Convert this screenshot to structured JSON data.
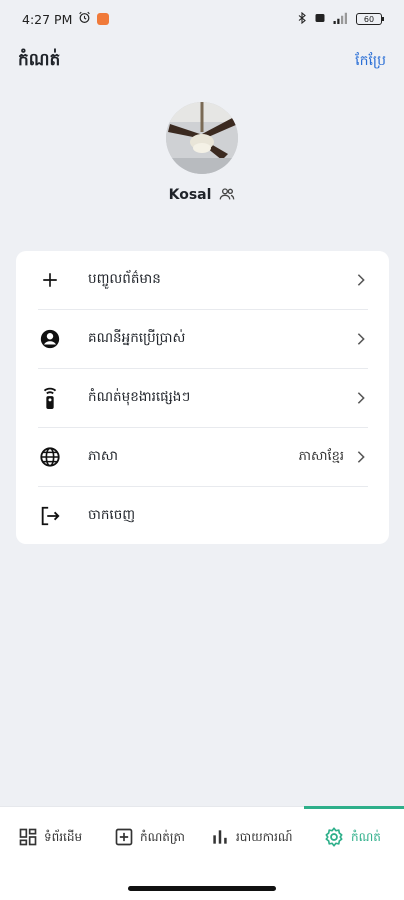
{
  "status_bar": {
    "time": "4:27 PM",
    "alarm_icon": "alarm-icon",
    "battery": "60"
  },
  "header": {
    "title": "កំណត់",
    "edit_label": "កែប្រែ"
  },
  "profile": {
    "username": "Kosal",
    "avatar": "ceiling-fan-photo"
  },
  "menu": {
    "items": [
      {
        "label": "បញ្ចូលព័ត៌មាន",
        "icon": "plus-icon"
      },
      {
        "label": "គណនីអ្នកប្រើប្រាស់",
        "icon": "account-circle-icon"
      },
      {
        "label": "កំណត់មុខងារផ្សេងៗ",
        "icon": "remote-icon"
      },
      {
        "label": "ភាសា",
        "value": "ភាសាខ្មែរ",
        "icon": "globe-icon"
      },
      {
        "label": "ចាកចេញ",
        "icon": "logout-icon"
      }
    ]
  },
  "bottom_nav": {
    "items": [
      {
        "label": "ទំព័រដើម",
        "icon": "dashboard-icon"
      },
      {
        "label": "កំណត់ត្រា",
        "icon": "add-box-icon"
      },
      {
        "label": "របាយការណ៍",
        "icon": "bar-chart-icon"
      },
      {
        "label": "កំណត់",
        "icon": "settings-icon"
      }
    ],
    "active_index": 3,
    "accent": "#2eaf8a"
  },
  "colors": {
    "background": "#eef0f4",
    "card": "#ffffff",
    "link": "#2a6fd6"
  }
}
